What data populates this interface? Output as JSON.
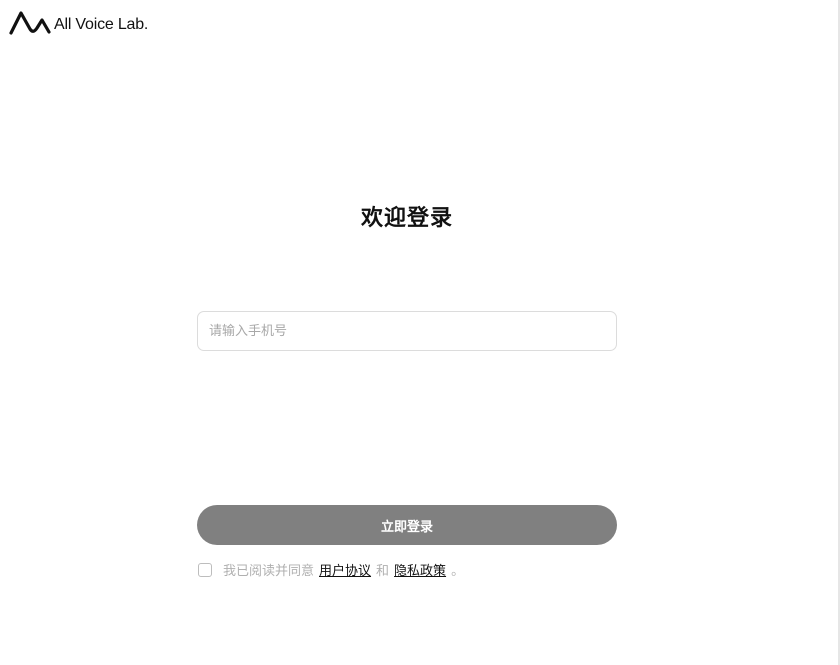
{
  "brand": {
    "name": "All Voice Lab."
  },
  "login": {
    "title": "欢迎登录",
    "phone_placeholder": "请输入手机号",
    "submit_label": "立即登录"
  },
  "agreement": {
    "prefix": "我已阅读并同意",
    "user_agreement": "用户协议",
    "conjunction": "和",
    "privacy_policy": "隐私政策",
    "suffix": "。",
    "checked": false
  },
  "colors": {
    "button_bg": "#808080",
    "text_primary": "#111111",
    "text_muted": "#b0b0b0",
    "input_border": "#dcdcdc"
  },
  "icons": {
    "logo": "wave-logo-icon",
    "checkbox": "checkbox-icon"
  }
}
